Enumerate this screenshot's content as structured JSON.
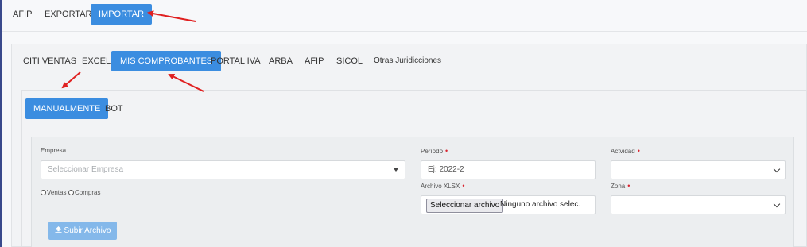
{
  "top_tabs": [
    {
      "label": "AFIP",
      "active": false
    },
    {
      "label": "EXPORTAR",
      "active": false
    },
    {
      "label": "IMPORTAR",
      "active": true
    }
  ],
  "import_tabs": [
    {
      "label": "CITI VENTAS",
      "active": false
    },
    {
      "label": "EXCEL",
      "active": false
    },
    {
      "label": "MIS COMPROBANTES",
      "active": true
    },
    {
      "label": "PORTAL IVA",
      "active": false
    },
    {
      "label": "ARBA",
      "active": false
    },
    {
      "label": "AFIP",
      "active": false
    },
    {
      "label": "SICOL",
      "active": false
    },
    {
      "label": "Otras Juridicciones",
      "active": false
    }
  ],
  "mode_tabs": [
    {
      "label": "MANUALMENTE",
      "active": true
    },
    {
      "label": "BOT",
      "active": false
    }
  ],
  "form": {
    "empresa_label": "Empresa",
    "empresa_placeholder": "Seleccionar Empresa",
    "radio_ventas": "Ventas",
    "radio_compras": "Compras",
    "periodo_label": "Período",
    "periodo_placeholder": "Ej: 2022-2",
    "archivo_label": "Archivo XLSX",
    "file_button": "Seleccionar archivo",
    "file_status": "Ninguno archivo selec.",
    "actividad_label": "Actvidad",
    "actividad_value": "",
    "zona_label": "Zona",
    "zona_value": "",
    "required_mark": "•",
    "upload_button": "Subir Archivo"
  },
  "annotation_color": "#e02020",
  "icons": [
    "upload-icon",
    "dropdown-caret-icon",
    "chevron-down-icon",
    "red-arrow"
  ]
}
